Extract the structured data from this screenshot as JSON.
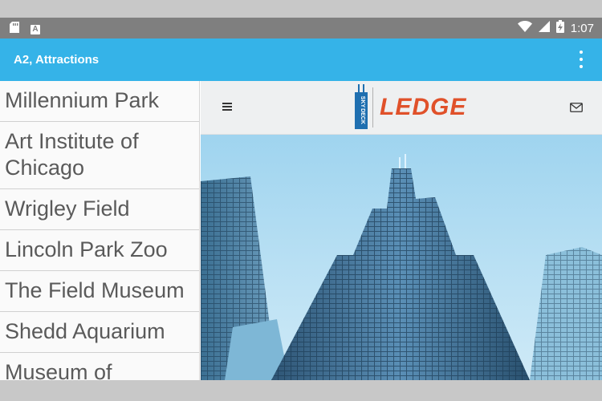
{
  "status_bar": {
    "time": "1:07",
    "icons": [
      "sd-card-icon",
      "keyboard-a-icon",
      "wifi-icon",
      "cell-signal-icon",
      "battery-charging-icon"
    ],
    "keyboard_glyph": "A"
  },
  "app_bar": {
    "title": "A2, Attractions",
    "color": "#35b3e8"
  },
  "attractions": [
    "Millennium Park",
    "Art Institute of Chicago",
    "Wrigley Field",
    "Lincoln Park Zoo",
    "The Field Museum",
    "Shedd Aquarium",
    "Museum of"
  ],
  "web_view": {
    "logo_text": "LEDGE",
    "logo_mark_text": "SKY DECK",
    "accent_color": "#e0512a",
    "icons": [
      "hamburger-menu-icon",
      "mail-icon"
    ]
  }
}
